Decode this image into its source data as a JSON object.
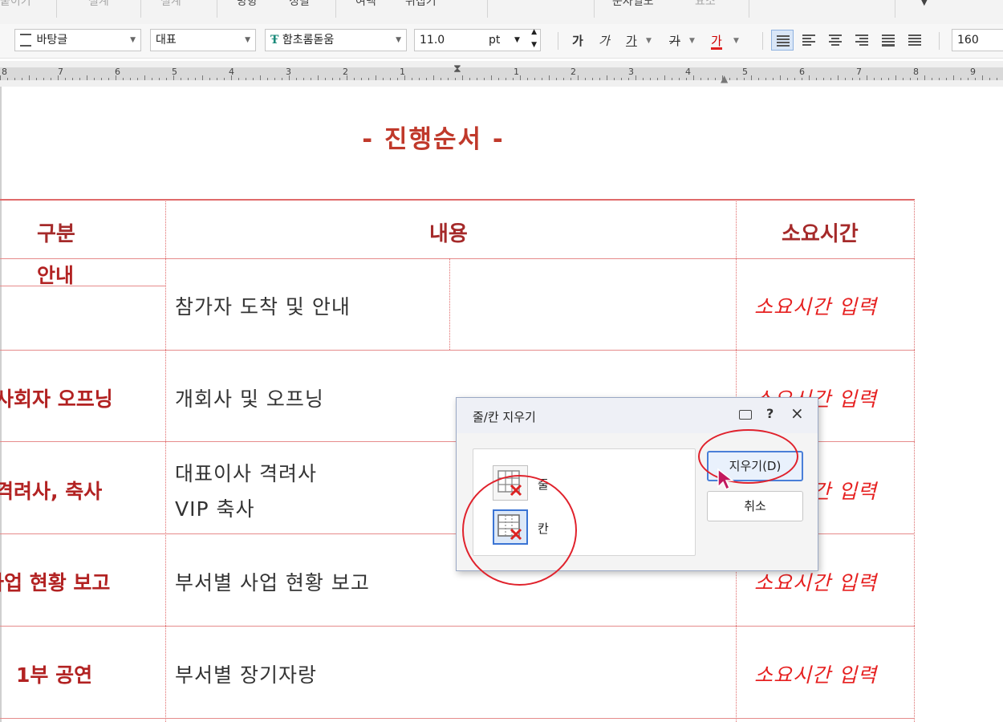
{
  "menu": {
    "items": [
      {
        "label": "붙이기",
        "dim": true
      },
      {
        "label": "설계",
        "dim": true
      },
      {
        "label": "설계",
        "dim": true
      },
      {
        "label": "방향",
        "dim": false
      },
      {
        "label": "정렬",
        "dim": false
      },
      {
        "label": "여백",
        "dim": false
      },
      {
        "label": "뒤집기",
        "dim": false
      },
      {
        "label": "문자열도",
        "dim": false
      },
      {
        "label": "요소",
        "dim": true
      }
    ]
  },
  "toolbar": {
    "style": "바탕글",
    "language": "대표",
    "font": "함초롬돋움",
    "font_size": "11.0",
    "unit": "pt",
    "bold": "가",
    "italic": "가",
    "underline": "가",
    "strike": "가",
    "font_color": "가",
    "line_spacing": "160"
  },
  "ruler": {
    "labels": [
      "8",
      "7",
      "6",
      "5",
      "4",
      "3",
      "2",
      "1",
      "1",
      "2",
      "3",
      "4",
      "5",
      "6",
      "7",
      "8",
      "9"
    ]
  },
  "document": {
    "title": "- 진행순서 -",
    "header": {
      "col1": "구분",
      "col2": "내용",
      "col3": "소요시간"
    },
    "rows": [
      {
        "category": "안내",
        "content": "참가자 도착 및 안내",
        "time": "소요시간 입력"
      },
      {
        "category": "사회자 오프닝",
        "content": "개회사 및 오프닝",
        "time": "소요시간 입력"
      },
      {
        "category": "격려사, 축사",
        "content": "대표이사 격려사",
        "content2": "VIP 축사",
        "time": "소요시간 입력"
      },
      {
        "category": "사업 현황 보고",
        "content": "부서별 사업 현황 보고",
        "time": "소요시간 입력"
      },
      {
        "category": "1부 공연",
        "content": "부서별 장기자랑",
        "time": "소요시간 입력"
      }
    ]
  },
  "dialog": {
    "title": "줄/칸 지우기",
    "help": "?",
    "close": "×",
    "option_row": "줄",
    "option_col": "칸",
    "delete_button": "지우기(D)",
    "cancel_button": "취소"
  },
  "colors": {
    "heading_red": "#c0392b",
    "time_red": "#e62020",
    "highlight_circle": "#e0222c",
    "dialog_accent": "#4a7fd8"
  }
}
